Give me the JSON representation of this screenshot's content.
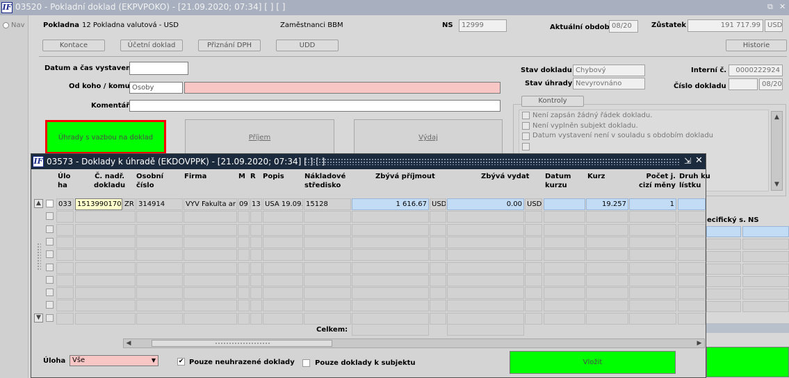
{
  "main_window": {
    "title": "03520 - Pokladní doklad (EKPVPOKO) - [21.09.2020; 07:34]  [ ]  [ ]",
    "restore_glyph": "⧉",
    "close_glyph": "✕",
    "nav_label": "Nav",
    "pokladna_label": "Pokladna",
    "pokladna_value": "12 Pokladna valutová - USD",
    "zamestnanci": "Zaměstnanci BBM",
    "ns_label": "NS",
    "ns_value": "12999",
    "obdobi_label": "Aktuální období",
    "obdobi_value": "08/20",
    "zustatek_label": "Zůstatek",
    "zustatek_value": "191 717.99",
    "zustatek_currency": "USD",
    "buttons": [
      "Kontace",
      "Účetní doklad",
      "Přiznání DPH",
      "UDD"
    ],
    "historie_button": "Historie",
    "datum_label": "Datum a čas vystavení",
    "od_koho_label": "Od koho / komu",
    "od_koho_value": "Osoby",
    "komentar_label": "Komentář",
    "stav_dokladu_label": "Stav dokladu",
    "stav_dokladu_value": "Chybový",
    "stav_uhrady_label": "Stav úhrady",
    "stav_uhrady_value": "Nevyrovnáno",
    "interni_label": "Interní č.",
    "interni_value": "0000222924",
    "cislo_dokladu_label": "Číslo dokladu",
    "cislo_dokladu_value": "08/20",
    "uhrady_button": "Úhrady s vazbou na doklad",
    "prijem_button": "Příjem",
    "vydej_button": "Výdaj",
    "kontroly_tab": "Kontroly",
    "kontroly_items": [
      "Není zapsán žádný řádek dokladu.",
      "Není vyplněn subjekt dokladu.",
      "Datum vystavení není v souladu s obdobím dokladu"
    ],
    "right_headers": [
      "ecifický s.",
      "NS"
    ],
    "vlozit_button": "Vložit",
    "accent_green": "#00ff00"
  },
  "modal": {
    "title": "03573 - Doklady k úhradě (EKDOVPPK) - [21.09.2020; 07:34]  [ ]  [ ]",
    "minimize_glyph": "⇲",
    "close_glyph": "✕",
    "headers": {
      "uloha": [
        "Úlo",
        "ha"
      ],
      "c_nadr": [
        "Č. nadř.",
        "dokladu"
      ],
      "osobni": [
        "Osobní",
        "číslo"
      ],
      "firma": "Firma",
      "m": "M",
      "r": "R",
      "popis": "Popis",
      "nakladove": [
        "Nákladové",
        "středisko"
      ],
      "zbyva_prijmout": "Zbývá příjmout",
      "zbyva_vydat": "Zbývá vydat",
      "datum_kurzu": [
        "Datum",
        "kurzu"
      ],
      "kurz": "Kurz",
      "pocet_j": [
        "Počet j.",
        "cizí měny"
      ],
      "druh": [
        "Druh ku",
        "lístku"
      ]
    },
    "row": {
      "uloha": "033",
      "c_nadr": "1513990170",
      "zr": "ZR",
      "osobni": "314914",
      "firma": "VYV Fakulta ar",
      "m": "09",
      "r": "13",
      "popis": "USA 19.09.",
      "nakladove": "15128",
      "zbyva_prijmout": "1 616.67",
      "mena1": "USD",
      "zbyva_vydat": "0.00",
      "mena2": "USD",
      "datum_kurzu": "",
      "kurz": "19.257",
      "pocet_j": "1",
      "druh": ""
    },
    "celkem_label": "Celkem:",
    "uloha_label": "Úloha",
    "uloha_value": "Vše",
    "pouze_neuhrazene": "Pouze neuhrazené doklady",
    "pouze_neuhrazene_checked": true,
    "pouze_subjekt": "Pouze doklady k subjektu",
    "pouze_subjekt_checked": false,
    "check_glyph": "✔"
  }
}
